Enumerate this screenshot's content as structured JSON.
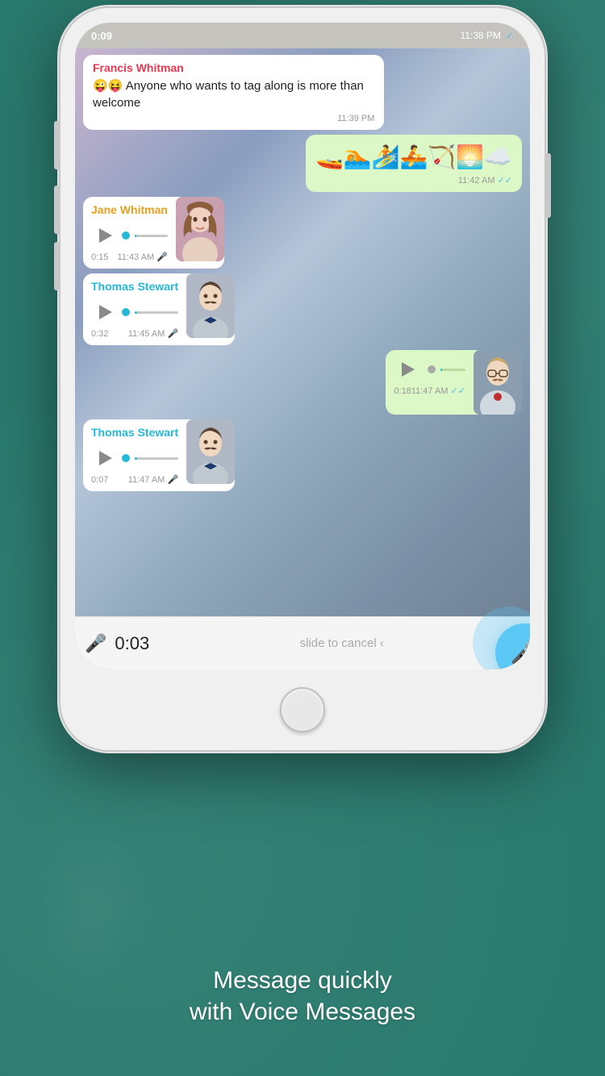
{
  "status_bar": {
    "time": "0:09",
    "right_time": "11:38 PM",
    "checkmark": "✓"
  },
  "messages": [
    {
      "id": "msg1",
      "type": "text_incoming",
      "sender": "Francis Whitman",
      "sender_color": "francis",
      "text": "😜😝 Anyone who wants to tag along is more than welcome",
      "time": "11:39 PM",
      "show_check": false
    },
    {
      "id": "msg2",
      "type": "emoji_outgoing",
      "text": "🚤🏊🏄🚣🏹🌅☁️",
      "time": "11:42 AM",
      "show_check": true
    },
    {
      "id": "msg3",
      "type": "voice_incoming",
      "sender": "Jane Whitman",
      "sender_color": "jane",
      "duration": "0:15",
      "time": "11:43 AM",
      "avatar": "jane"
    },
    {
      "id": "msg4",
      "type": "voice_incoming",
      "sender": "Thomas Stewart",
      "sender_color": "thomas",
      "duration": "0:32",
      "time": "11:45 AM",
      "avatar": "thomas"
    },
    {
      "id": "msg5",
      "type": "voice_outgoing",
      "duration": "0:18",
      "time": "11:47 AM",
      "show_check": true,
      "avatar": "self"
    },
    {
      "id": "msg6",
      "type": "voice_incoming",
      "sender": "Thomas Stewart",
      "sender_color": "thomas",
      "duration": "0:07",
      "time": "11:47 AM",
      "avatar": "thomas"
    }
  ],
  "input_bar": {
    "timer": "0:03",
    "slide_label": "slide to cancel ‹",
    "mic_color": "#e8384f"
  },
  "bottom_text": {
    "line1": "Message quickly",
    "line2": "with Voice Messages"
  }
}
